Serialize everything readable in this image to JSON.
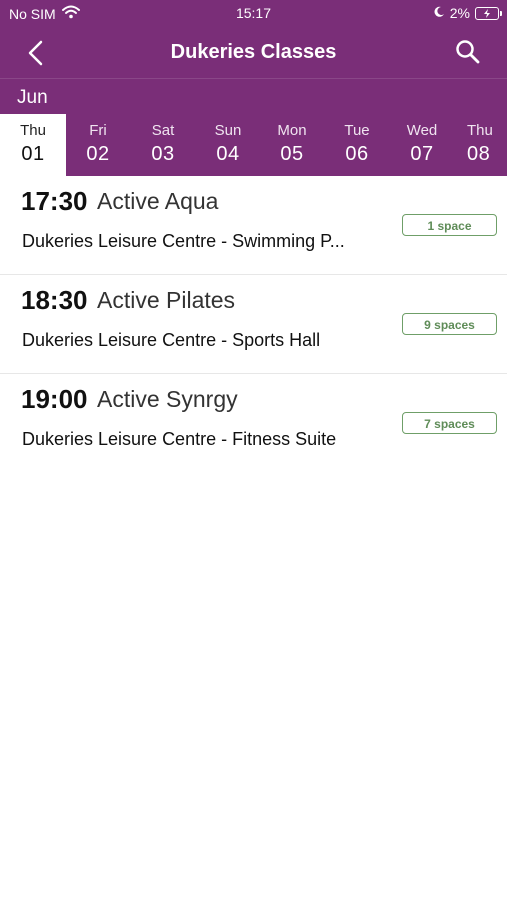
{
  "status_bar": {
    "carrier": "No SIM",
    "time": "15:17",
    "battery": "2%"
  },
  "header": {
    "title": "Dukeries Classes"
  },
  "calendar": {
    "month": "Jun",
    "days": [
      {
        "name": "Thu",
        "num": "01",
        "selected": true
      },
      {
        "name": "Fri",
        "num": "02"
      },
      {
        "name": "Sat",
        "num": "03"
      },
      {
        "name": "Sun",
        "num": "04"
      },
      {
        "name": "Mon",
        "num": "05"
      },
      {
        "name": "Tue",
        "num": "06"
      },
      {
        "name": "Wed",
        "num": "07"
      },
      {
        "name": "Thu",
        "num": "08"
      }
    ]
  },
  "classes": [
    {
      "time": "17:30",
      "name": "Active Aqua",
      "venue": "Dukeries Leisure Centre - Swimming P...",
      "spaces": "1 space"
    },
    {
      "time": "18:30",
      "name": "Active Pilates",
      "venue": "Dukeries Leisure Centre - Sports Hall",
      "spaces": "9 spaces"
    },
    {
      "time": "19:00",
      "name": "Active Synrgy",
      "venue": "Dukeries Leisure Centre - Fitness Suite",
      "spaces": "7 spaces"
    }
  ],
  "colors": {
    "brand": "#7a2e78",
    "badge": "#6f9f68"
  }
}
